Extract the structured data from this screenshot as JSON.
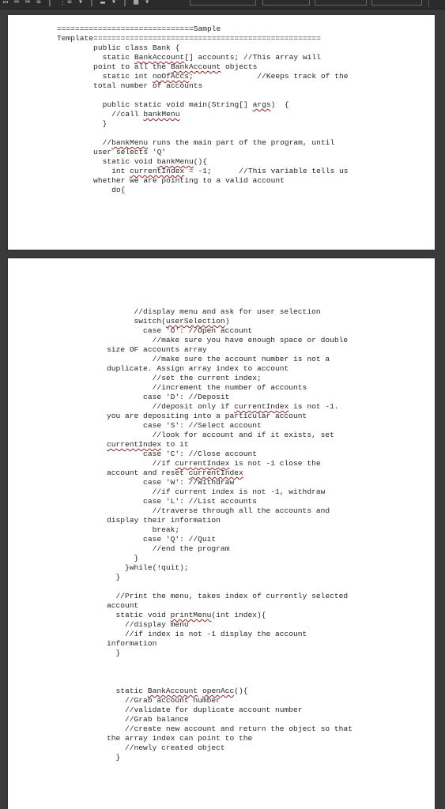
{
  "page1_lines": [
    "==============================Sample",
    "Template==================================================",
    [
      {
        "t": "        public class Bank {"
      }
    ],
    [
      {
        "t": "          static "
      },
      {
        "t": "BankAccount",
        "sq": true
      },
      {
        "t": "[] accounts; //This array will"
      }
    ],
    [
      {
        "t": "        point to all the "
      },
      {
        "t": "BankAccount",
        "sq": true
      },
      {
        "t": " objects"
      }
    ],
    [
      {
        "t": "          static int "
      },
      {
        "t": "noOfAccs",
        "sq": true
      },
      {
        "t": ";              //Keeps track of the"
      }
    ],
    "        total number of accounts",
    "",
    [
      {
        "t": "          public static void main(String[] "
      },
      {
        "t": "args",
        "sq": true
      },
      {
        "t": ")  {"
      }
    ],
    [
      {
        "t": "            //call "
      },
      {
        "t": "bankMenu",
        "sq": true
      }
    ],
    "          }",
    "",
    [
      {
        "t": "          //"
      },
      {
        "t": "bankMenu",
        "sq": true
      },
      {
        "t": " runs the main part of the program, until"
      }
    ],
    "        user selects 'Q'",
    [
      {
        "t": "          static void "
      },
      {
        "t": "bankMenu",
        "sq": true
      },
      {
        "t": "(){"
      }
    ],
    [
      {
        "t": "            int "
      },
      {
        "t": "currentIndex",
        "sq": true
      },
      {
        "t": " = -1;      //This variable tells us"
      }
    ],
    "        whether we are pointing to a valid account",
    "            do{"
  ],
  "page2_lines": [
    "      //display menu and ask for user selection",
    [
      {
        "t": "      switch("
      },
      {
        "t": "userSelection",
        "sq": true
      },
      {
        "t": ")"
      }
    ],
    "        case 'O': //Open account",
    "          //make sure you have enough space or double",
    "size OF accounts array",
    "          //make sure the account number is not a",
    "duplicate. Assign array index to account",
    "          //set the current index;",
    "          //increment the number of accounts",
    "        case 'D': //Deposit",
    [
      {
        "t": "          //deposit only if "
      },
      {
        "t": "currentIndex",
        "sq": true
      },
      {
        "t": " is not -1."
      }
    ],
    "you are depositing into a particular account",
    "        case 'S': //Select account",
    "          //look for account and if it exists, set",
    [
      {
        "t": "currentIndex",
        "sq": true
      },
      {
        "t": " to it"
      }
    ],
    "        case 'C': //Close account",
    [
      {
        "t": "          //if "
      },
      {
        "t": "currentIndex",
        "sq": true
      },
      {
        "t": " is not -1 close the"
      }
    ],
    [
      {
        "t": "account and reset "
      },
      {
        "t": "currentIndex",
        "sq": true
      }
    ],
    "        case 'W': //Withdraw",
    "          //if current index is not -1, withdraw",
    "        case 'L': //List accounts",
    "          //traverse through all the accounts and",
    "display their information",
    "          break;",
    "        case 'Q': //Quit",
    "          //end the program",
    "      }",
    "    }while(!quit);",
    "  }",
    "",
    "  //Print the menu, takes index of currently selected",
    "account",
    [
      {
        "t": "  static void "
      },
      {
        "t": "printMenu",
        "sq": true
      },
      {
        "t": "(int index){"
      }
    ],
    "    //display menu",
    "    //if index is not -1 display the account",
    "information",
    "  }",
    "",
    "",
    "",
    [
      {
        "t": "  static "
      },
      {
        "t": "BankAccount",
        "sq": true
      },
      {
        "t": " "
      },
      {
        "t": "openAcc",
        "sq": true
      },
      {
        "t": "(){"
      }
    ],
    "    //Grab account number",
    "    //validate for duplicate account number",
    "    //Grab balance",
    "    //create new account and return the object so that",
    "the array index can point to the",
    "    //newly created object",
    "  }"
  ]
}
